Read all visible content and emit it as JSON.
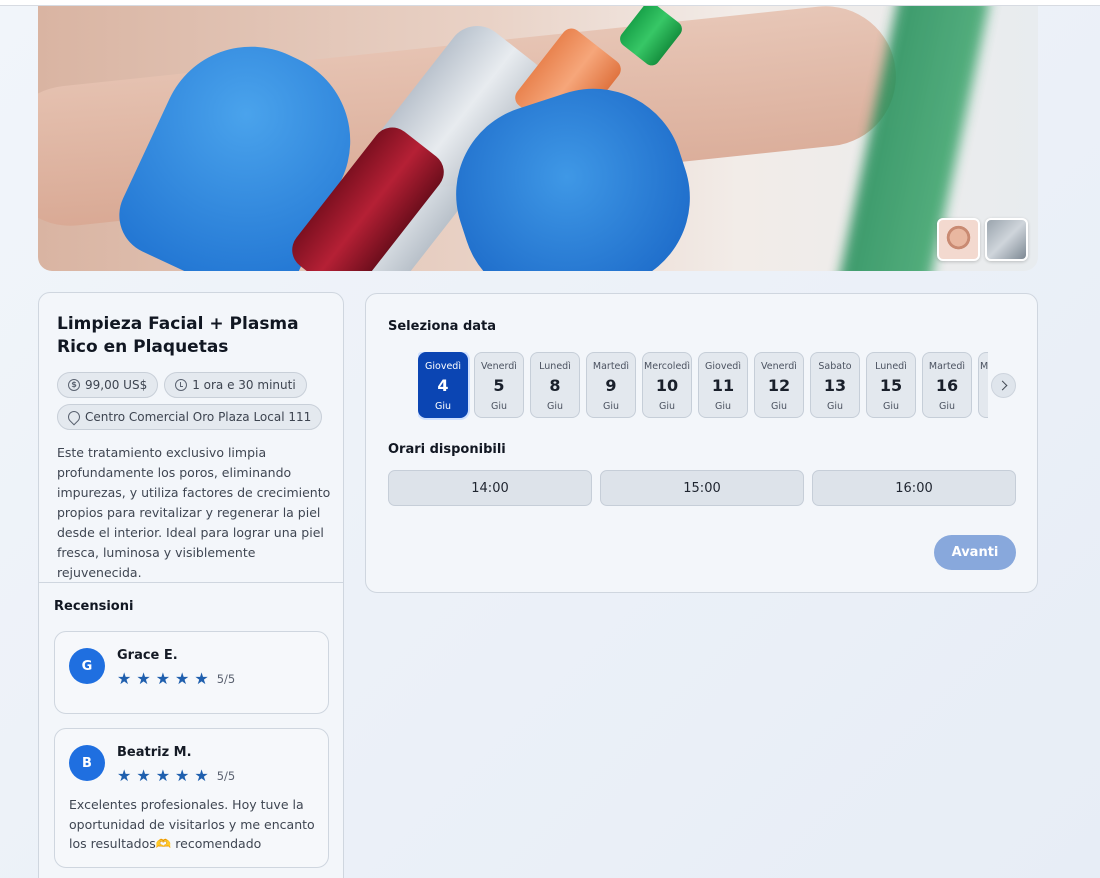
{
  "service": {
    "title": "Limpieza Facial + Plasma Rico en Plaquetas",
    "price": "99,00 US$",
    "duration": "1 ora e 30 minuti",
    "location": "Centro Comercial Oro Plaza Local 111",
    "description": "Este tratamiento exclusivo limpia profundamente los poros, eliminando impurezas, y utiliza factores de crecimiento propios para revitalizar y regenerar la piel desde el interior. Ideal para lograr una piel fresca, luminosa y visiblemente rejuvenecida."
  },
  "reviews": {
    "title": "Recensioni",
    "items": [
      {
        "initial": "G",
        "name": "Grace E.",
        "rating": "5/5",
        "stars": 5,
        "text": ""
      },
      {
        "initial": "B",
        "name": "Beatriz M.",
        "rating": "5/5",
        "stars": 5,
        "text": "Excelentes profesionales. Hoy tuve la oportunidad de visitarlos y me encanto los resultados🫶 recomendado"
      }
    ]
  },
  "booking": {
    "date_title": "Seleziona data",
    "times_title": "Orari disponibili",
    "dates": [
      {
        "day": "Giovedì",
        "num": "4",
        "month": "Giu",
        "selected": true
      },
      {
        "day": "Venerdì",
        "num": "5",
        "month": "Giu"
      },
      {
        "day": "Lunedì",
        "num": "8",
        "month": "Giu"
      },
      {
        "day": "Martedì",
        "num": "9",
        "month": "Giu"
      },
      {
        "day": "Mercoledì",
        "num": "10",
        "month": "Giu"
      },
      {
        "day": "Giovedì",
        "num": "11",
        "month": "Giu"
      },
      {
        "day": "Venerdì",
        "num": "12",
        "month": "Giu"
      },
      {
        "day": "Sabato",
        "num": "13",
        "month": "Giu"
      },
      {
        "day": "Lunedì",
        "num": "15",
        "month": "Giu"
      },
      {
        "day": "Martedì",
        "num": "16",
        "month": "Giu"
      },
      {
        "day": "Mercoledì",
        "num": "",
        "month": ""
      }
    ],
    "times": [
      "14:00",
      "15:00",
      "16:00"
    ],
    "next_label": "Avanti"
  },
  "colors": {
    "accent": "#0b45b3",
    "star": "#1f5fae",
    "avatar": "#1f6fe0"
  }
}
